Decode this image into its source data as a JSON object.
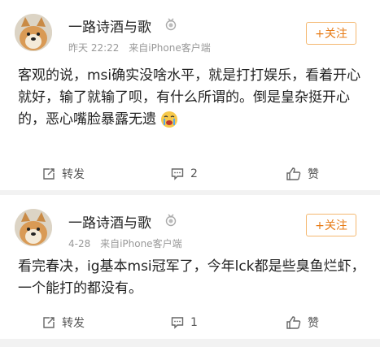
{
  "posts": [
    {
      "username": "一路诗酒与歌",
      "time": "昨天 22:22",
      "source": "来自iPhone客户端",
      "follow_label": "+关注",
      "content": "客观的说，msi确实没啥水平，就是打打娱乐，看着开心就好，输了就输了呗，有什么所谓的。倒是皇杂挺开心的，恶心嘴脸暴露无遗",
      "repost_label": "转发",
      "comment_count": "2",
      "like_label": "赞"
    },
    {
      "username": "一路诗酒与歌",
      "time": "4-28",
      "source": "来自iPhone客户端",
      "follow_label": "+关注",
      "content": "看完春决，ig基本msi冠军了，今年lck都是些臭鱼烂虾，一个能打的都没有。",
      "repost_label": "转发",
      "comment_count": "1",
      "like_label": "赞"
    }
  ],
  "colors": {
    "accent": "#e77b16",
    "follow_border": "#f4b870",
    "meta": "#999999",
    "bg": "#f2f2f2"
  },
  "icons": [
    "avatar-shiba-dog",
    "medal-icon",
    "repost-icon",
    "comment-icon",
    "like-icon",
    "crying-emoji-icon"
  ]
}
